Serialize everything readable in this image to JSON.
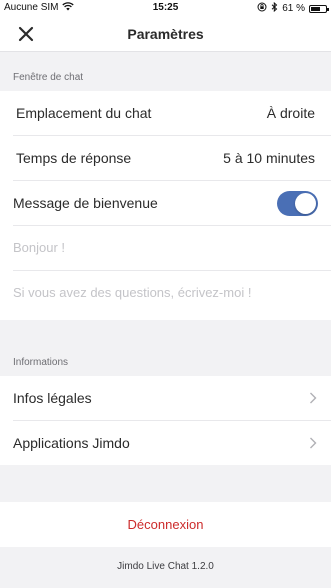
{
  "status_bar": {
    "carrier": "Aucune SIM",
    "time": "15:25",
    "battery": "61 %",
    "battery_level": 0.61
  },
  "header": {
    "title": "Paramètres"
  },
  "chat_window": {
    "section_title": "Fenêtre de chat",
    "location_label": "Emplacement du chat",
    "location_value": "À droite",
    "response_label": "Temps de réponse",
    "response_value": "5 à 10 minutes",
    "welcome_label": "Message de bienvenue",
    "welcome_enabled": true,
    "greeting_placeholder": "Bonjour !",
    "message_placeholder": "Si vous avez des questions, écrivez-moi !"
  },
  "information": {
    "section_title": "Informations",
    "legal_label": "Infos légales",
    "apps_label": "Applications Jimdo"
  },
  "logout_label": "Déconnexion",
  "version": "Jimdo Live Chat 1.2.0",
  "colors": {
    "accent": "#4a6fb5",
    "danger": "#cc2b2b"
  }
}
